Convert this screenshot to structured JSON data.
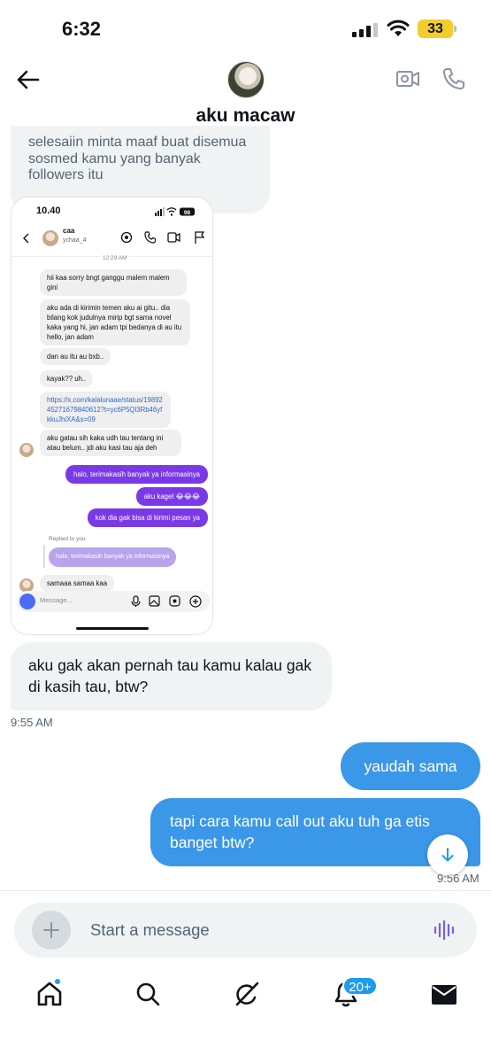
{
  "status_bar": {
    "time": "6:32",
    "battery": "33"
  },
  "header": {
    "contact_name": "aku macaw"
  },
  "messages": {
    "top_lines": [
      "selesaiin minta maaf buat disemua",
      "sosmed kamu yang banyak",
      "followers itu"
    ],
    "received": "aku gak akan pernah tau kamu kalau gak di kasih tau, btw?",
    "received_time": "9:55 AM",
    "sent_1": "yaudah sama",
    "sent_2": "tapi cara kamu call out aku tuh ga etis banget btw?",
    "sent_time": "9:56 AM"
  },
  "embedded_screenshot": {
    "time": "10.40",
    "battery": "98",
    "name": "caa",
    "handle": "ychaa_4",
    "timestamp": "12:29 AM",
    "incoming": [
      "hii kaa sorry bngt ganggu malem malem gini",
      "aku ada di kirimin temen aku ai gitu.. dia bilang kok judulnya mirip bgt sama novel kaka yang hi, jan adam tpi bedanya di au itu hello, jan adam",
      "dan au itu au bxb..",
      "kayak?? uh..",
      "https://x.com/kalalunaae/status/1989245271679840612?t=yc6P5Ql3Rb46yfkkuJhiXA&s=09",
      "aku gatau sih kaka udh tau tentang ini atau belum.. jdi aku kasi tau aja deh"
    ],
    "outgoing": [
      "halo, terimakasih banyak ya informasinya",
      "aku kaget 😂😂😂",
      "kok dia gak bisa di kirimi pesan ya"
    ],
    "replied_label": "Replied to you",
    "replied_text": "halo, terimakasih banyak ya informasinya",
    "last_incoming": "samaaa samaa kaa",
    "input_placeholder": "Message..."
  },
  "composer": {
    "placeholder": "Start a message"
  },
  "tab_bar": {
    "notifications_badge": "20+"
  },
  "colors": {
    "sent_bubble": "#3b97e8",
    "received_bubble": "#eff3f4",
    "accent": "#1d9bf0",
    "embedded_sent": "#7a39e6"
  },
  "icons": [
    "back-arrow-icon",
    "video-call-icon",
    "phone-icon",
    "scroll-down-icon",
    "plus-icon",
    "voice-icon",
    "home-icon",
    "search-icon",
    "grok-icon",
    "bell-icon",
    "mail-icon"
  ]
}
